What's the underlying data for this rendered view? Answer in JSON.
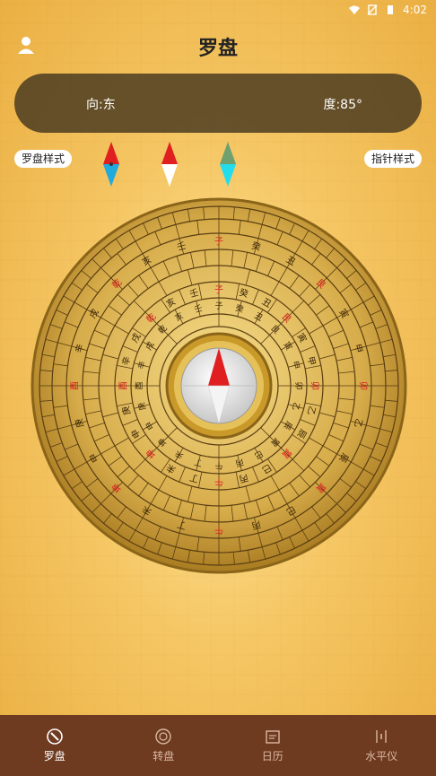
{
  "status_bar": {
    "time": "4:02"
  },
  "header": {
    "title": "罗盘"
  },
  "info": {
    "direction": "向:东",
    "degree": "度:85°"
  },
  "buttons": {
    "compass_style": "罗盘样式",
    "needle_style": "指针样式"
  },
  "compass": {
    "rings": [
      [
        "子",
        "癸",
        "丑",
        "艮",
        "寅",
        "甲",
        "卯",
        "乙",
        "辰",
        "巽",
        "巳",
        "丙",
        "午",
        "丁",
        "未",
        "坤",
        "申",
        "庚",
        "酉",
        "辛",
        "戌",
        "乾",
        "亥",
        "壬"
      ]
    ]
  },
  "nav": {
    "items": [
      {
        "label": "罗盘",
        "icon": "compass-icon",
        "active": true
      },
      {
        "label": "转盘",
        "icon": "dial-icon",
        "active": false
      },
      {
        "label": "日历",
        "icon": "calendar-icon",
        "active": false
      },
      {
        "label": "水平仪",
        "icon": "level-icon",
        "active": false
      }
    ]
  },
  "colors": {
    "nav_bg": "#6e3a20",
    "accent_red": "#e02020",
    "panel": "#46371e"
  }
}
